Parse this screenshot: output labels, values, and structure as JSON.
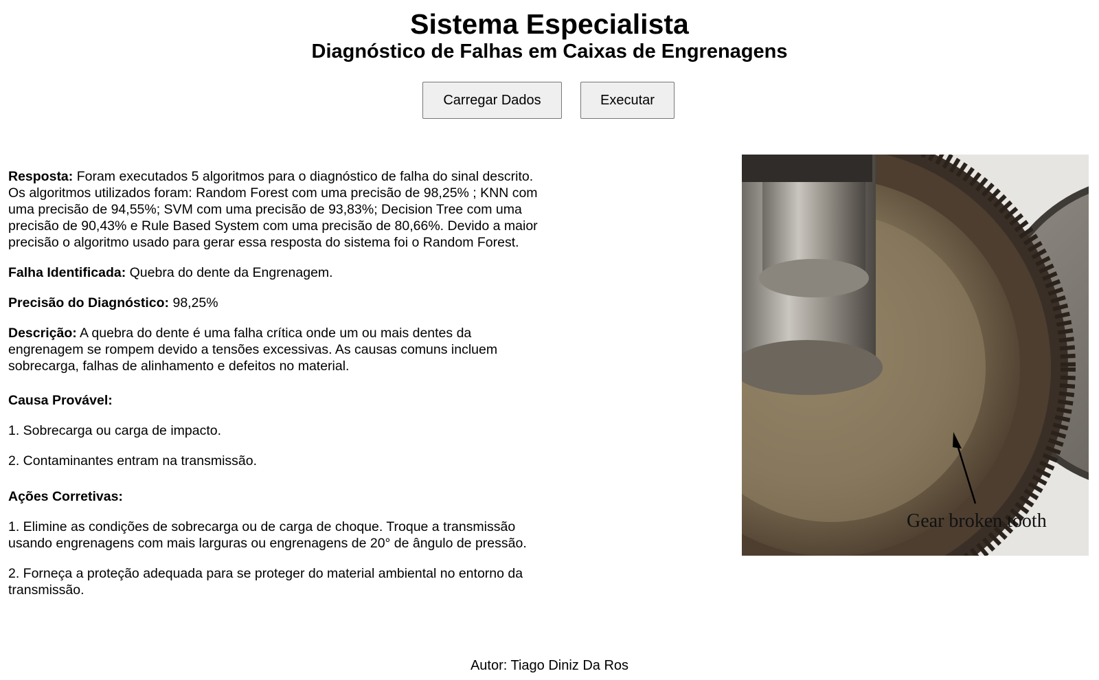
{
  "header": {
    "title": "Sistema Especialista",
    "subtitle": "Diagnóstico de Falhas em Caixas de Engrenagens"
  },
  "toolbar": {
    "load_label": "Carregar Dados",
    "run_label": "Executar"
  },
  "result": {
    "response_label": "Resposta:",
    "response_text": " Foram executados 5 algoritmos para o diagnóstico de falha do sinal descrito. Os algoritmos utilizados foram: Random Forest com uma precisão de 98,25% ; KNN com uma precisão de 94,55%; SVM com uma precisão de 93,83%; Decision Tree com uma precisão de 90,43% e Rule Based System com uma precisão de 80,66%. Devido a maior precisão o algoritmo usado para gerar essa resposta do sistema foi o Random Forest.",
    "fault_label": "Falha Identificada:",
    "fault_value": " Quebra do dente da Engrenagem.",
    "precision_label": "Precisão do Diagnóstico:",
    "precision_value": " 98,25%",
    "description_label": "Descrição:",
    "description_text": " A quebra do dente é uma falha crítica onde um ou mais dentes da engrenagem se rompem devido a tensões excessivas. As causas comuns incluem sobrecarga, falhas de alinhamento e defeitos no material.",
    "causes_title": "Causa Provável:",
    "causes": [
      "1. Sobrecarga ou carga de impacto.",
      "2. Contaminantes entram na transmissão."
    ],
    "actions_title": "Ações Corretivas:",
    "actions": [
      "1. Elimine as condições de sobrecarga ou de carga de choque. Troque a transmissão usando engrenagens com mais larguras ou engrenagens de 20° de ângulo de pressão.",
      "2. Forneça a proteção adequada para se proteger do material ambiental no entorno da transmissão."
    ]
  },
  "image": {
    "caption": "Gear broken tooth"
  },
  "footer": {
    "author": "Autor: Tiago Diniz Da Ros"
  }
}
